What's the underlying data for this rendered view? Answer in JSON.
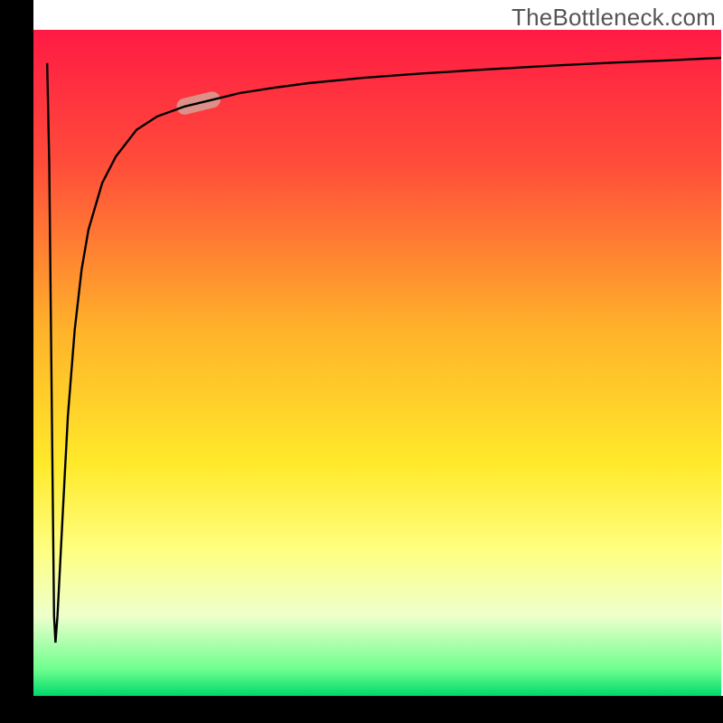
{
  "watermark": "TheBottleneck.com",
  "chart_data": {
    "type": "line",
    "title": "",
    "xlabel": "",
    "ylabel": "",
    "xlim": [
      0,
      100
    ],
    "ylim": [
      0,
      100
    ],
    "background": {
      "type": "vertical-gradient",
      "stops": [
        {
          "y": 0,
          "color": "#ff1a44"
        },
        {
          "y": 20,
          "color": "#ff4c3a"
        },
        {
          "y": 45,
          "color": "#ffb22a"
        },
        {
          "y": 65,
          "color": "#ffe92a"
        },
        {
          "y": 78,
          "color": "#ffff80"
        },
        {
          "y": 88,
          "color": "#eeffcc"
        },
        {
          "y": 96,
          "color": "#6eff8f"
        },
        {
          "y": 100,
          "color": "#00d86a"
        }
      ]
    },
    "axes_color": "#000000",
    "series": [
      {
        "name": "bottleneck-curve",
        "color": "#000000",
        "stroke_width": 2.2,
        "annotation": {
          "type": "highlight-segment",
          "x_range": [
            20,
            28
          ],
          "color": "#d99a8f",
          "thickness": 18
        },
        "x": [
          2.0,
          2.3,
          2.6,
          3.0,
          3.2,
          3.5,
          4.0,
          4.5,
          5.0,
          6.0,
          7.0,
          8.0,
          10.0,
          12.0,
          15.0,
          18.0,
          22.0,
          26.0,
          30.0,
          35.0,
          40.0,
          48.0,
          56.0,
          65.0,
          75.0,
          85.0,
          92.0,
          100.0
        ],
        "y": [
          5.0,
          20.0,
          50.0,
          88.0,
          92.0,
          88.0,
          78.0,
          68.0,
          58.0,
          45.0,
          36.0,
          30.0,
          23.0,
          19.0,
          15.0,
          13.0,
          11.5,
          10.5,
          9.5,
          8.7,
          8.0,
          7.2,
          6.6,
          6.0,
          5.4,
          4.9,
          4.6,
          4.2
        ]
      }
    ],
    "note": "y-values are percent distance from top of plot interior (0=top,100=bottom); curve drops from top to bottom near x≈3 then rises back toward the top asymptotically."
  }
}
